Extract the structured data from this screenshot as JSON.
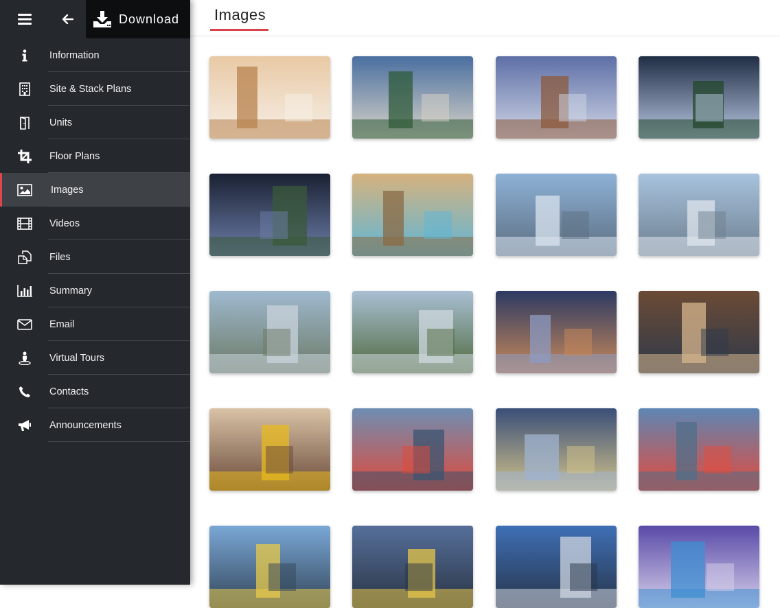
{
  "topbar": {
    "download_label": "Download"
  },
  "nav": [
    {
      "label": "Information",
      "icon": "info-icon"
    },
    {
      "label": "Site & Stack Plans",
      "icon": "building-icon"
    },
    {
      "label": "Units",
      "icon": "door-icon"
    },
    {
      "label": "Floor Plans",
      "icon": "crop-icon"
    },
    {
      "label": "Images",
      "icon": "image-icon",
      "active": true
    },
    {
      "label": "Videos",
      "icon": "film-icon"
    },
    {
      "label": "Files",
      "icon": "files-icon"
    },
    {
      "label": "Summary",
      "icon": "bar-chart-icon"
    },
    {
      "label": "Email",
      "icon": "envelope-icon"
    },
    {
      "label": "Virtual Tours",
      "icon": "street-view-icon"
    },
    {
      "label": "Contacts",
      "icon": "phone-icon"
    },
    {
      "label": "Announcements",
      "icon": "megaphone-icon"
    }
  ],
  "page": {
    "title": "Images"
  },
  "images": [
    {
      "scene": "bedroom",
      "palette": [
        "#e9c9a5",
        "#b8834f",
        "#f6efe6"
      ]
    },
    {
      "scene": "lobby-exterior",
      "palette": [
        "#4a6fa0",
        "#2f5b39",
        "#d8d3c8"
      ]
    },
    {
      "scene": "lobby-night",
      "palette": [
        "#5e6fa6",
        "#8c5a3c",
        "#cfd6e6"
      ]
    },
    {
      "scene": "lobby-trees",
      "palette": [
        "#1f2d45",
        "#23472c",
        "#b8c8e0"
      ]
    },
    {
      "scene": "dropoff-night",
      "palette": [
        "#1a2133",
        "#3b5a3a",
        "#6c7da8"
      ]
    },
    {
      "scene": "unit-balcony",
      "palette": [
        "#d6b27e",
        "#8a6a44",
        "#5fb6d6"
      ]
    },
    {
      "scene": "tower-day",
      "palette": [
        "#8db1d6",
        "#d9e3ee",
        "#5d6f82"
      ]
    },
    {
      "scene": "tower-day-2",
      "palette": [
        "#a7c3de",
        "#dfe6ee",
        "#6f7f8f"
      ]
    },
    {
      "scene": "tower-city",
      "palette": [
        "#9fb9cf",
        "#c9d3dc",
        "#6b7a66"
      ]
    },
    {
      "scene": "tower-green",
      "palette": [
        "#a9bfd3",
        "#cfd8e0",
        "#4f6a3f"
      ]
    },
    {
      "scene": "tower-dusk",
      "palette": [
        "#2d3a63",
        "#8d9bc2",
        "#c98a5a"
      ]
    },
    {
      "scene": "living-room",
      "palette": [
        "#6b4a35",
        "#d7b68d",
        "#2f3a4a"
      ]
    },
    {
      "scene": "living-yellow",
      "palette": [
        "#d9c3a6",
        "#e8b91f",
        "#6a4a3a"
      ]
    },
    {
      "scene": "rooftop-aerial",
      "palette": [
        "#6e8eb3",
        "#3a5470",
        "#e04a3a"
      ]
    },
    {
      "scene": "skydeck",
      "palette": [
        "#3a4f78",
        "#9fb3d0",
        "#d2c28a"
      ]
    },
    {
      "scene": "rooftop-pool",
      "palette": [
        "#5d86b4",
        "#4f6f8a",
        "#e34b3b"
      ]
    },
    {
      "scene": "glass-lounge",
      "palette": [
        "#7aa8d6",
        "#e8c94a",
        "#34465a"
      ]
    },
    {
      "scene": "glass-lounge-night",
      "palette": [
        "#556f9a",
        "#e6c54a",
        "#2a3444"
      ]
    },
    {
      "scene": "sky-bar",
      "palette": [
        "#3e6fb5",
        "#cfd6e0",
        "#27354a"
      ]
    },
    {
      "scene": "pool-corridor",
      "palette": [
        "#5a4aa8",
        "#3f8fd2",
        "#d6d0ea"
      ]
    }
  ]
}
